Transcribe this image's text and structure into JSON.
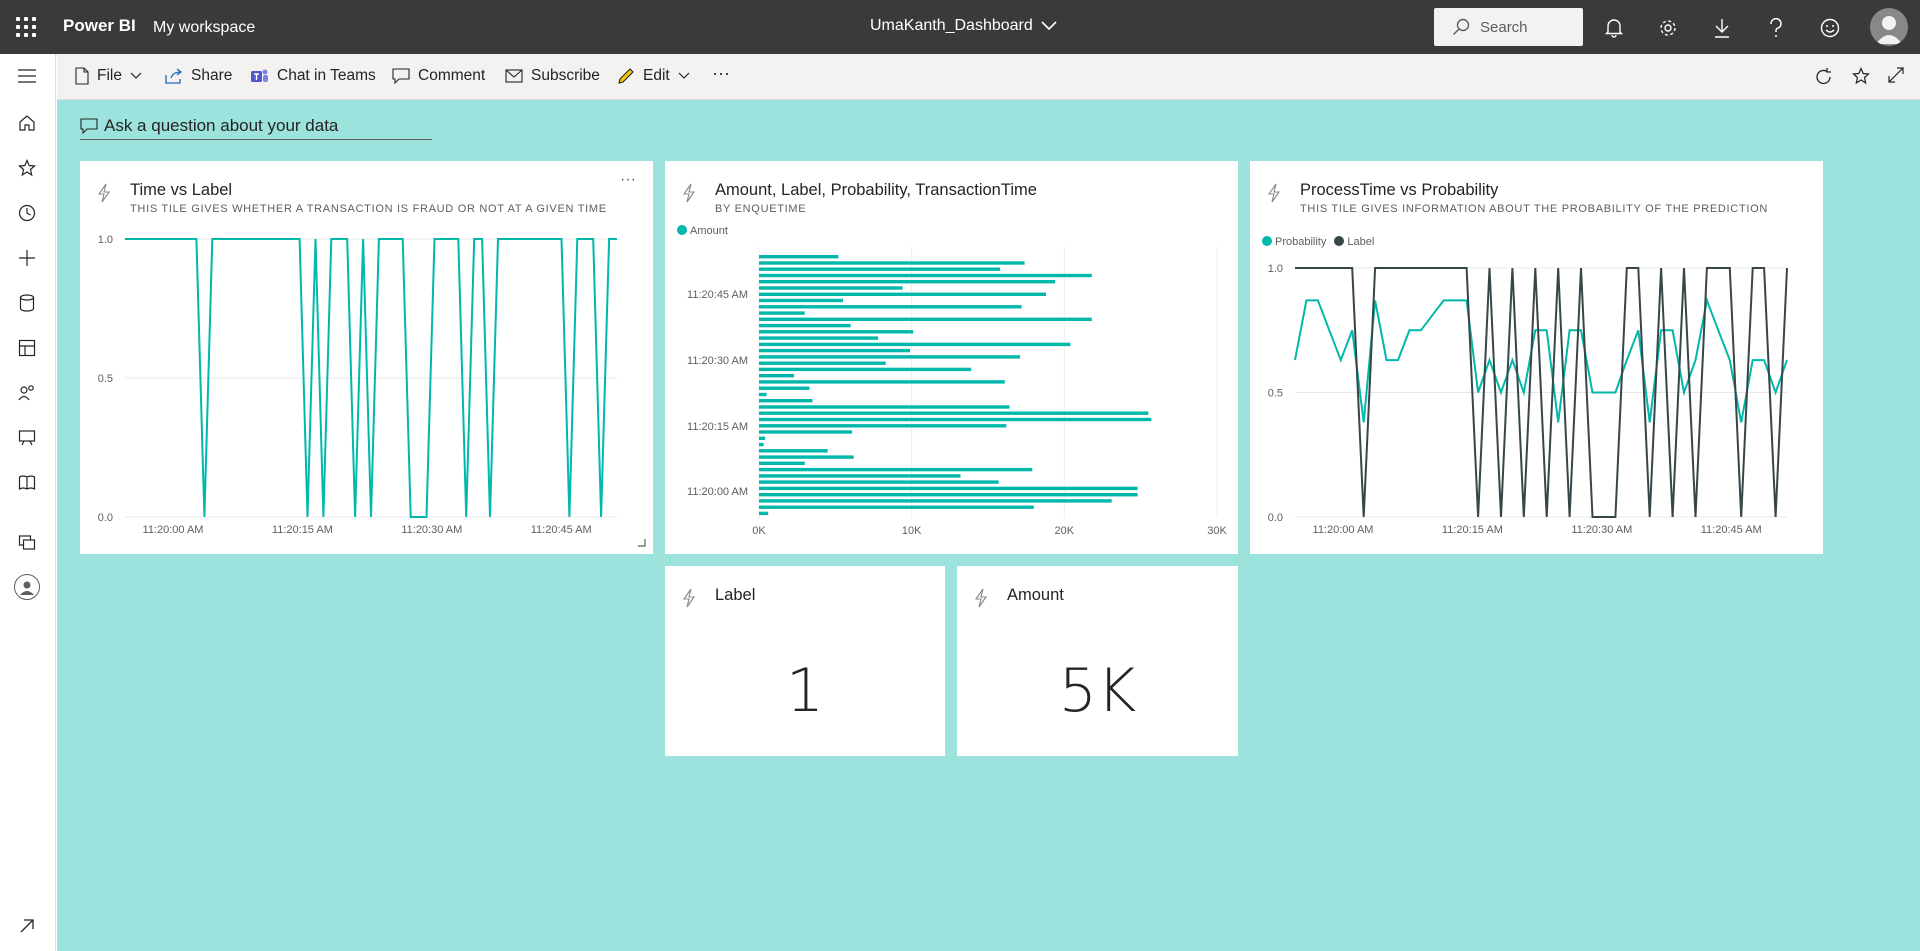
{
  "topbar": {
    "brand": "Power BI",
    "workspace": "My workspace",
    "dashboard_title": "UmaKanth_Dashboard",
    "search_placeholder": "Search"
  },
  "actionbar": {
    "file": "File",
    "share": "Share",
    "chat_in_teams": "Chat in Teams",
    "comment": "Comment",
    "subscribe": "Subscribe",
    "edit": "Edit",
    "more": "···"
  },
  "qa": {
    "label": "Ask a question about your data"
  },
  "colors": {
    "accent": "#01b8aa",
    "dark": "#374649",
    "canvas": "#9be3dc",
    "topbar": "#3b3a39"
  },
  "tiles": {
    "time_vs_label": {
      "title": "Time vs Label",
      "subtitle": "THIS TILE GIVES WHETHER A TRANSACTION IS FRAUD OR NOT AT A GIVEN TIME",
      "more": "···"
    },
    "amount_bars": {
      "title": "Amount, Label, Probability, TransactionTime",
      "subtitle": "BY ENQUETIME"
    },
    "process_prob": {
      "title": "ProcessTime vs Probability",
      "subtitle": "THIS TILE GIVES INFORMATION ABOUT THE PROBABILITY OF THE PREDICTION"
    },
    "label_card": {
      "title": "Label",
      "value": "1"
    },
    "amount_card": {
      "title": "Amount",
      "value": "5K"
    }
  },
  "chart_data": [
    {
      "type": "line",
      "title": "Time vs Label",
      "y_ticks": [
        "1.0",
        "0.5",
        "0.0"
      ],
      "x_ticks": [
        "11:20:00 AM",
        "11:20:15 AM",
        "11:20:30 AM",
        "11:20:45 AM"
      ],
      "ylim": [
        0,
        1
      ],
      "series": [
        {
          "values": [
            1,
            1,
            1,
            1,
            1,
            1,
            1,
            1,
            1,
            1,
            0,
            1,
            1,
            1,
            1,
            1,
            1,
            1,
            1,
            1,
            1,
            1,
            1,
            0,
            1,
            0,
            1,
            1,
            1,
            0,
            1,
            0,
            1,
            1,
            1,
            1,
            0,
            0,
            0,
            1,
            1,
            1,
            1,
            0,
            1,
            1,
            0,
            1,
            1,
            1,
            1,
            1,
            1,
            1,
            1,
            1,
            0,
            1,
            1,
            1,
            0,
            1,
            1
          ]
        }
      ],
      "grid": true
    },
    {
      "type": "bar",
      "title": "Amount, Label, Probability, TransactionTime",
      "orientation": "horizontal",
      "x_ticks": [
        "0K",
        "10K",
        "20K",
        "30K"
      ],
      "xlim": [
        0,
        30000
      ],
      "y_ticks": [
        "11:20:45 AM",
        "11:20:30 AM",
        "11:20:15 AM",
        "11:20:00 AM"
      ],
      "legend": [
        "Amount"
      ],
      "series": [
        {
          "name": "Amount",
          "values": [
            5200,
            17400,
            15800,
            21800,
            19400,
            9400,
            18800,
            5500,
            17200,
            3000,
            21800,
            6000,
            10100,
            7800,
            20400,
            9900,
            17100,
            8300,
            13900,
            2300,
            16100,
            3300,
            500,
            3500,
            16400,
            25500,
            25700,
            16200,
            6100,
            400,
            300,
            4500,
            6200,
            3000,
            17900,
            13200,
            15700,
            24800,
            24800,
            23100,
            18000,
            600
          ]
        }
      ]
    },
    {
      "type": "line",
      "title": "ProcessTime vs Probability",
      "y_ticks": [
        "1.0",
        "0.5",
        "0.0"
      ],
      "x_ticks": [
        "11:20:00 AM",
        "11:20:15 AM",
        "11:20:30 AM",
        "11:20:45 AM"
      ],
      "ylim": [
        0,
        1
      ],
      "legend": [
        "Probability",
        "Label"
      ],
      "series": [
        {
          "name": "Probability",
          "values": [
            0.63,
            0.87,
            0.87,
            0.75,
            0.63,
            0.75,
            0.38,
            0.87,
            0.63,
            0.63,
            0.75,
            0.75,
            0.81,
            0.87,
            0.87,
            0.87,
            0.5,
            0.63,
            0.5,
            0.63,
            0.5,
            0.75,
            0.75,
            0.38,
            0.75,
            0.75,
            0.5,
            0.5,
            0.5,
            0.63,
            0.75,
            0.38,
            0.75,
            0.75,
            0.5,
            0.63,
            0.87,
            0.75,
            0.63,
            0.38,
            0.63,
            0.63,
            0.5,
            0.63
          ]
        },
        {
          "name": "Label",
          "values": [
            1,
            1,
            1,
            1,
            1,
            1,
            0,
            1,
            1,
            1,
            1,
            1,
            1,
            1,
            1,
            1,
            0,
            1,
            0,
            1,
            0,
            1,
            0,
            1,
            0,
            1,
            0,
            0,
            0,
            1,
            1,
            0,
            1,
            0,
            1,
            0,
            1,
            1,
            1,
            0,
            1,
            1,
            0,
            1
          ]
        }
      ],
      "grid": true
    },
    {
      "type": "card",
      "title": "Label",
      "value": 1
    },
    {
      "type": "card",
      "title": "Amount",
      "value": "5K"
    }
  ]
}
